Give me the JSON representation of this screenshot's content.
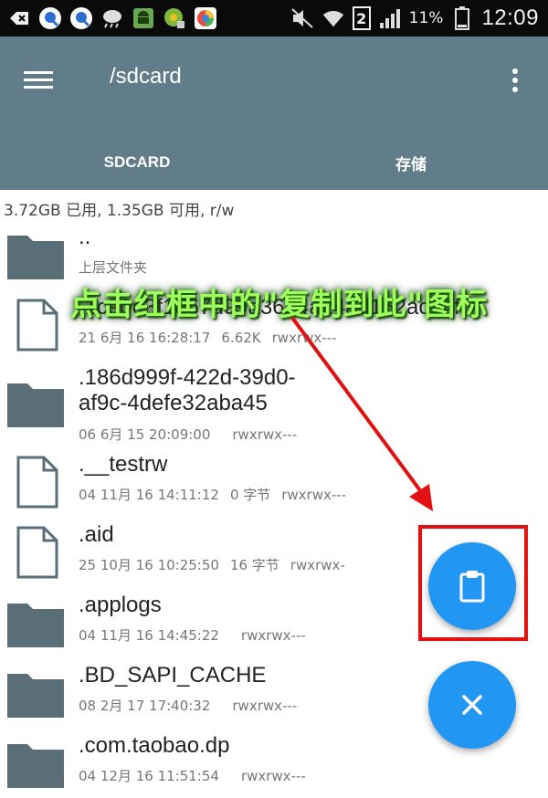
{
  "status_bar": {
    "battery_percent": "11%",
    "clock": "12:09",
    "sim_slot": "2"
  },
  "app_bar": {
    "path": "/sdcard",
    "tabs": [
      {
        "label": "SDCARD",
        "selected": true
      },
      {
        "label": "存储",
        "selected": false
      }
    ]
  },
  "storage_info": "3.72GB 已用, 1.35GB 可用, r/w",
  "files": [
    {
      "type": "folder",
      "name": "..",
      "name_line2": "",
      "date": "上层文件夹",
      "size": "",
      "perms": ""
    },
    {
      "type": "file",
      "name": ".1c90e3f1d67d99a3624a24ad152ac94f5",
      "name_line2": "",
      "date": "21 6月 16 16:28:17",
      "size": "6.62K",
      "perms": "rwxrwx---"
    },
    {
      "type": "folder",
      "name": ".186d999f-422d-39d0-",
      "name_line2": "af9c-4defe32aba45",
      "date": "06 6月 15 20:09:00",
      "size": "",
      "perms": "rwxrwx---"
    },
    {
      "type": "file",
      "name": ".__testrw",
      "name_line2": "",
      "date": "04 11月 16 14:11:12",
      "size": "0 字节",
      "perms": "rwxrwx---"
    },
    {
      "type": "file",
      "name": ".aid",
      "name_line2": "",
      "date": "25 10月 16 10:25:50",
      "size": "16 字节",
      "perms": "rwxrwx-"
    },
    {
      "type": "folder",
      "name": ".applogs",
      "name_line2": "",
      "date": "04 11月 16 14:45:22",
      "size": "",
      "perms": "rwxrwx---"
    },
    {
      "type": "folder",
      "name": ".BD_SAPI_CACHE",
      "name_line2": "",
      "date": "08 2月 17 17:40:32",
      "size": "",
      "perms": "rwxrwx---"
    },
    {
      "type": "folder",
      "name": ".com.taobao.dp",
      "name_line2": "",
      "date": "04 12月 16 11:51:54",
      "size": "",
      "perms": "rwxrwx---"
    }
  ],
  "annotation": {
    "text": "点击红框中的\"复制到此\"图标"
  },
  "fab": {
    "paste_icon": "clipboard-icon",
    "cancel_icon": "close-icon"
  },
  "colors": {
    "app_bar": "#617d8a",
    "fab": "#2196f3",
    "highlight": "#e21010",
    "annotation_text": "#9dff5a"
  }
}
